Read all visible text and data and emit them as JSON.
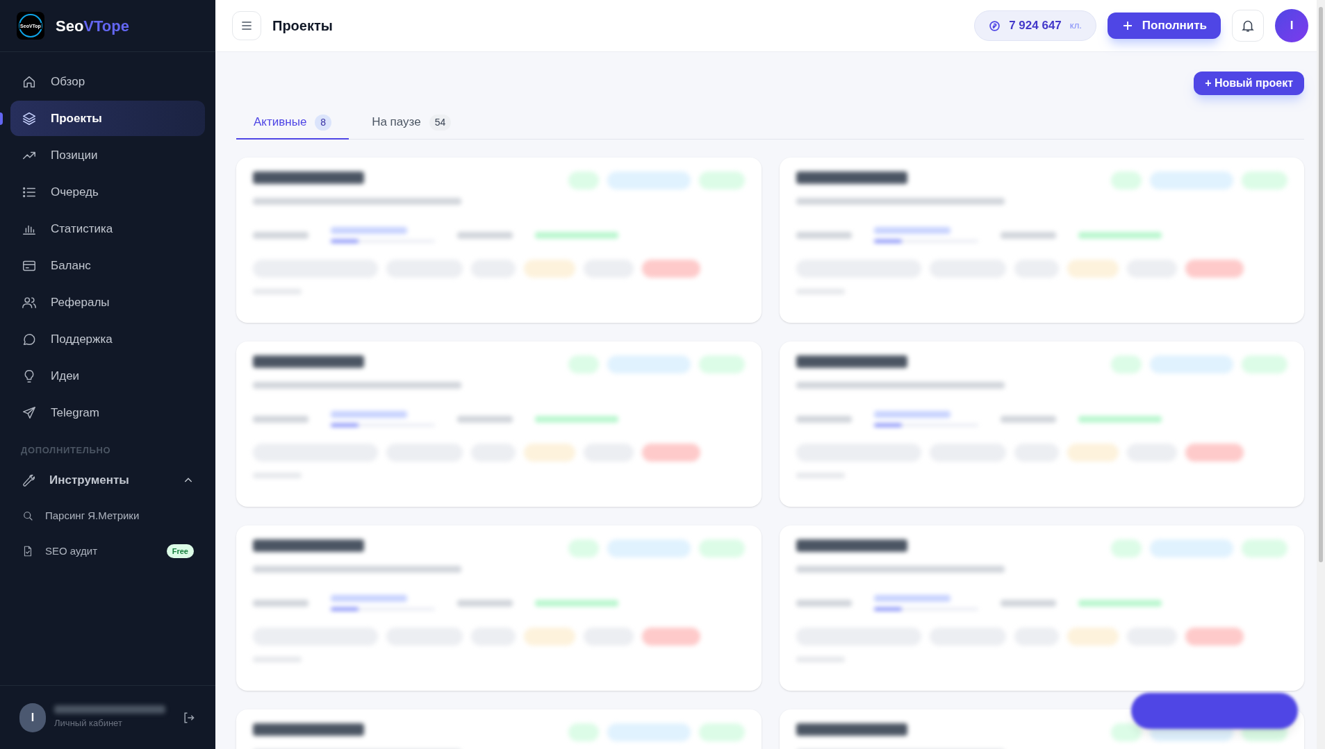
{
  "brand": {
    "prefix": "Seo",
    "suffix": "VTope",
    "logo_text": "SeoVTop"
  },
  "nav": [
    {
      "label": "Обзор",
      "selected": false
    },
    {
      "label": "Проекты",
      "selected": true
    },
    {
      "label": "Позиции",
      "selected": false
    },
    {
      "label": "Очередь",
      "selected": false
    },
    {
      "label": "Статистика",
      "selected": false
    },
    {
      "label": "Баланс",
      "selected": false
    },
    {
      "label": "Рефералы",
      "selected": false
    },
    {
      "label": "Поддержка",
      "selected": false
    },
    {
      "label": "Идеи",
      "selected": false
    },
    {
      "label": "Telegram",
      "selected": false
    }
  ],
  "section_label": "ДОПОЛНИТЕЛЬНО",
  "tools": {
    "label": "Инструменты",
    "expanded": true,
    "children": [
      {
        "label": "Парсинг Я.Метрики"
      },
      {
        "label": "SEO аудит",
        "badge": "Free"
      }
    ]
  },
  "user": {
    "avatar": "I",
    "caption": "Личный кабинет"
  },
  "header": {
    "title": "Проекты",
    "balance": "7 924 647",
    "balance_unit": "кл.",
    "topup": "Пополнить",
    "avatar": "I"
  },
  "new_project": "+ Новый проект",
  "tabs": [
    {
      "label": "Активные",
      "count": "8",
      "selected": true
    },
    {
      "label": "На паузе",
      "count": "54",
      "selected": false
    }
  ],
  "project_cards": [
    {
      "kind": "blurred"
    },
    {
      "kind": "blurred"
    },
    {
      "kind": "blurred"
    },
    {
      "kind": "blurred"
    },
    {
      "kind": "blurred"
    },
    {
      "kind": "blurred"
    },
    {
      "kind": "blurred"
    },
    {
      "kind": "blurred"
    }
  ]
}
